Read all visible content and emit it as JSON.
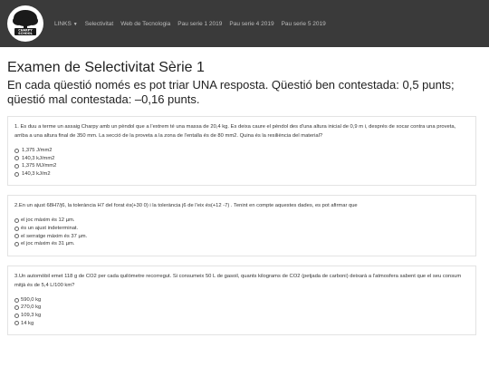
{
  "navbar": {
    "logo_text": "CHARPY SCHOOL",
    "links": [
      {
        "label": "LINKS",
        "has_caret": true
      },
      {
        "label": "Selectivitat"
      },
      {
        "label": "Web de Tecnologia"
      },
      {
        "label": "Pau serie 1 2019"
      },
      {
        "label": "Pau serie 4 2019"
      },
      {
        "label": "Pau serie 5 2019"
      }
    ],
    "caret_icon": "caret-down-icon"
  },
  "page": {
    "title": "Examen de Selectivitat Sèrie 1",
    "subtitle": "En cada qüestió només es pot triar UNA resposta. Qüestió ben contestada: 0,5 punts; qüestió mal contestada: –0,16 punts."
  },
  "questions": [
    {
      "text": "1. Es duu a terme un assaig Charpy amb un pèndol que a l'extrem té una massa de 20,4 kg. Es deixa caure el pèndol des d'una altura inicial de 0,9 m i, després de xocar contra una proveta, arriba a una altura final de 350 mm. La secció de la proveta a la zona de l'entalla és de 80 mm2. Quina és la resiliència del material?",
      "options": [
        "1,375 J/mm2",
        "140,3 kJ/mm2",
        "1,375 MJ/mm2",
        "140,3 kJ/m2"
      ]
    },
    {
      "text": "2.En un ajust 68H7/j6, la tolerància H7 del forat és(+30 0) i la tolerància j6 de l'eix és(+12 -7) . Tenint en compte aquestes dades, es pot afirmar que",
      "options": [
        "el joc màxim és 12 µm.",
        "és un ajust indeterminat.",
        "el serratge màxim és 37 µm.",
        "el joc màxim és 31 µm."
      ]
    },
    {
      "text": "3.Un automòbil emet 118 g de CO2 per cada quilòmetre recorregut. Si consumeix 50 L de gasoil, quants kilograms de CO2 (petjada de carboni) deixarà a l'atmosfera sabent que el seu consum mitjà és de 5,4 L/100 km?",
      "options": [
        "590,0 kg",
        "270,0 kg",
        "109,3 kg",
        "14 kg"
      ]
    }
  ]
}
